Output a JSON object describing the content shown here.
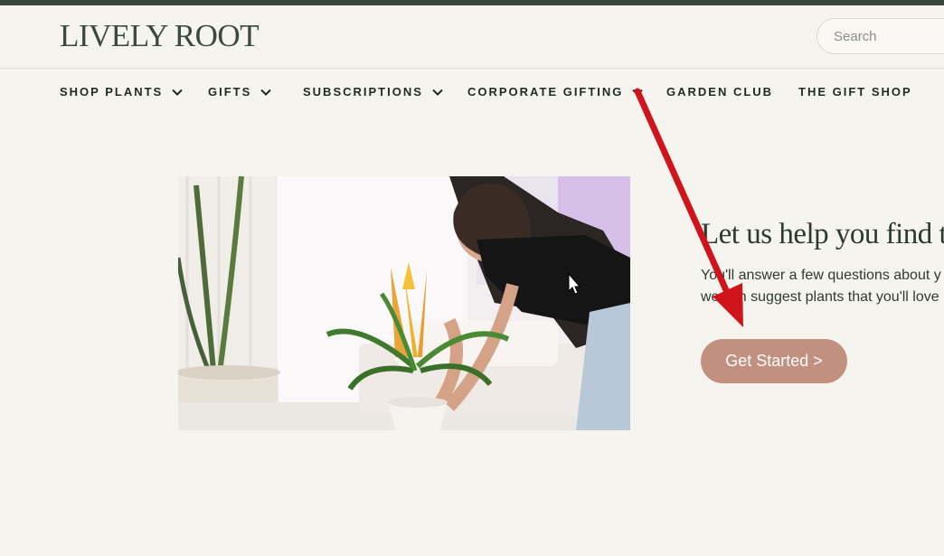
{
  "header": {
    "logo": "LIVELY ROOT",
    "search_placeholder": "Search"
  },
  "nav": {
    "items": [
      {
        "label": "SHOP PLANTS",
        "has_dropdown": true
      },
      {
        "label": "GIFTS",
        "has_dropdown": true
      },
      {
        "label": "SUBSCRIPTIONS",
        "has_dropdown": true
      },
      {
        "label": "CORPORATE GIFTING",
        "has_dropdown": true
      },
      {
        "label": "GARDEN CLUB",
        "has_dropdown": false
      },
      {
        "label": "THE GIFT SHOP",
        "has_dropdown": false
      }
    ]
  },
  "hero": {
    "headline": "Let us help you find t",
    "body_line1": "You'll answer a few questions about y",
    "body_line2": "we can suggest plants that you'll love",
    "cta_label": "Get Started >"
  },
  "colors": {
    "topbar": "#39463c",
    "background": "#f6f4ee",
    "cta": "#c2907f",
    "annotation_arrow": "#d0141b"
  },
  "icons": {
    "dropdown": "chevron-down-icon",
    "cursor": "mouse-pointer-icon",
    "annotation": "red-arrow-icon"
  }
}
